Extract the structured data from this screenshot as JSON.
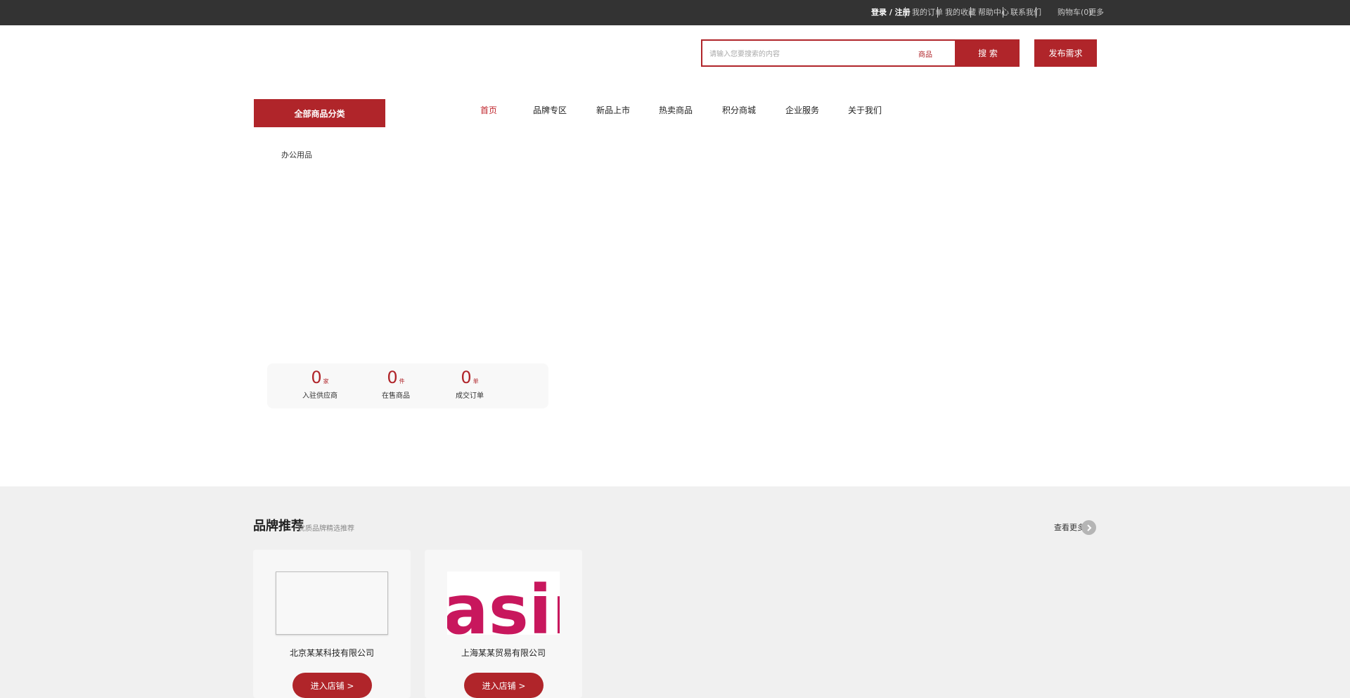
{
  "topbar": {
    "login_register": "登录 / 注册",
    "links": [
      "我的订单",
      "我的收藏",
      "帮助中心",
      "联系我们"
    ],
    "cart": "购物车(0)",
    "extra": "更多"
  },
  "search": {
    "placeholder": "请输入您要搜索的内容",
    "scope": "商品",
    "button": "搜 索"
  },
  "header_button": "发布需求",
  "nav": {
    "category_button": "全部商品分类",
    "items": [
      "首页",
      "品牌专区",
      "新品上市",
      "热卖商品",
      "积分商城",
      "企业服务",
      "关于我们"
    ]
  },
  "sidebar": {
    "item": "办公用品"
  },
  "stats": [
    {
      "value": "0",
      "unit": "家",
      "label": "入驻供应商"
    },
    {
      "value": "0",
      "unit": "件",
      "label": "在售商品"
    },
    {
      "value": "0",
      "unit": "单",
      "label": "成交订单"
    }
  ],
  "section": {
    "title": "品牌推荐",
    "subtitle": "优质品牌精选推荐",
    "more": "查看更多",
    "more_icon": "chevron-right-icon"
  },
  "cards": [
    {
      "name": "北京某某科技有限公司",
      "button": "进入店铺 >"
    },
    {
      "name": "上海某某贸易有限公司",
      "button": "进入店铺 >",
      "logo_text": "asin"
    }
  ],
  "colors": {
    "brand_red": "#b0252a",
    "topbar_bg": "#333333",
    "section_bg": "#f0f0f0"
  }
}
